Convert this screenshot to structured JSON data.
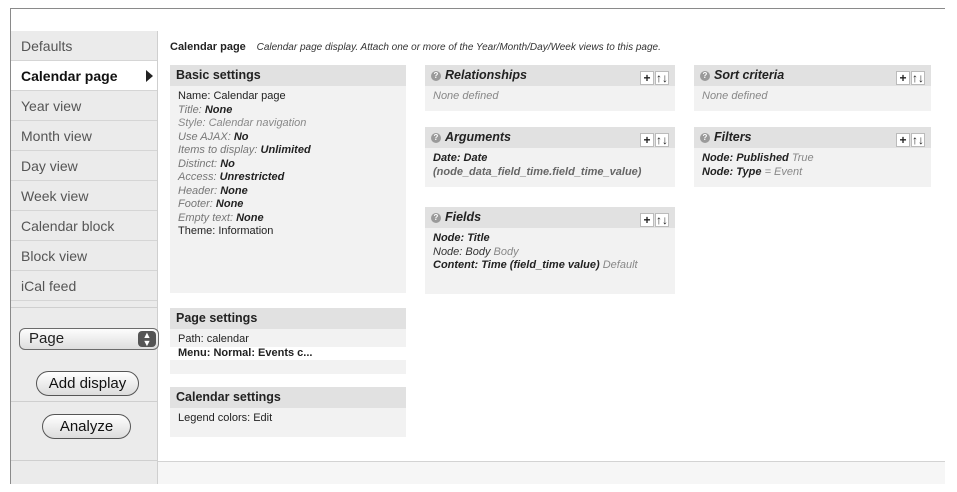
{
  "tabs": [
    {
      "label": "Defaults",
      "active": false
    },
    {
      "label": "Calendar page",
      "active": true
    },
    {
      "label": "Year view",
      "active": false
    },
    {
      "label": "Month view",
      "active": false
    },
    {
      "label": "Day view",
      "active": false
    },
    {
      "label": "Week view",
      "active": false
    },
    {
      "label": "Calendar block",
      "active": false
    },
    {
      "label": "Block view",
      "active": false
    },
    {
      "label": "iCal feed",
      "active": false
    }
  ],
  "display_select": {
    "value": "Page"
  },
  "add_display_label": "Add display",
  "analyze_label": "Analyze",
  "header": {
    "title": "Calendar page",
    "description": "Calendar page display. Attach one or more of the Year/Month/Day/Week views to this page."
  },
  "basic": {
    "title": "Basic settings",
    "name": "Name: Calendar page",
    "title_k": "Title:",
    "title_v": "None",
    "style": "Style: Calendar navigation",
    "ajax_k": "Use AJAX:",
    "ajax_v": "No",
    "items_k": "Items to display:",
    "items_v": "Unlimited",
    "distinct_k": "Distinct:",
    "distinct_v": "No",
    "access_k": "Access:",
    "access_v": "Unrestricted",
    "header_k": "Header:",
    "header_v": "None",
    "footer_k": "Footer:",
    "footer_v": "None",
    "empty_k": "Empty text:",
    "empty_v": "None",
    "theme": "Theme: Information"
  },
  "page_settings": {
    "title": "Page settings",
    "path": "Path: calendar",
    "menu": "Menu: Normal: Events c..."
  },
  "calendar_settings": {
    "title": "Calendar settings",
    "legend": "Legend colors: Edit"
  },
  "relationships": {
    "title": "Relationships",
    "empty": "None defined"
  },
  "arguments": {
    "title": "Arguments",
    "line1": "Date: Date",
    "line2": "(node_data_field_time.field_time_value)"
  },
  "fields": {
    "title": "Fields",
    "f1": "Node: Title",
    "f2": "Node: Body",
    "f2_g": "Body",
    "f3": "Content: Time (field_time value)",
    "f3_g": "Default"
  },
  "sort": {
    "title": "Sort criteria",
    "empty": "None defined"
  },
  "filters": {
    "title": "Filters",
    "f1": "Node: Published",
    "f1_g": "True",
    "f2": "Node: Type",
    "f2_g": "= Event"
  },
  "icons": {
    "help": "?",
    "add": "+",
    "rearrange": "↑↓",
    "updown": "⇕"
  }
}
